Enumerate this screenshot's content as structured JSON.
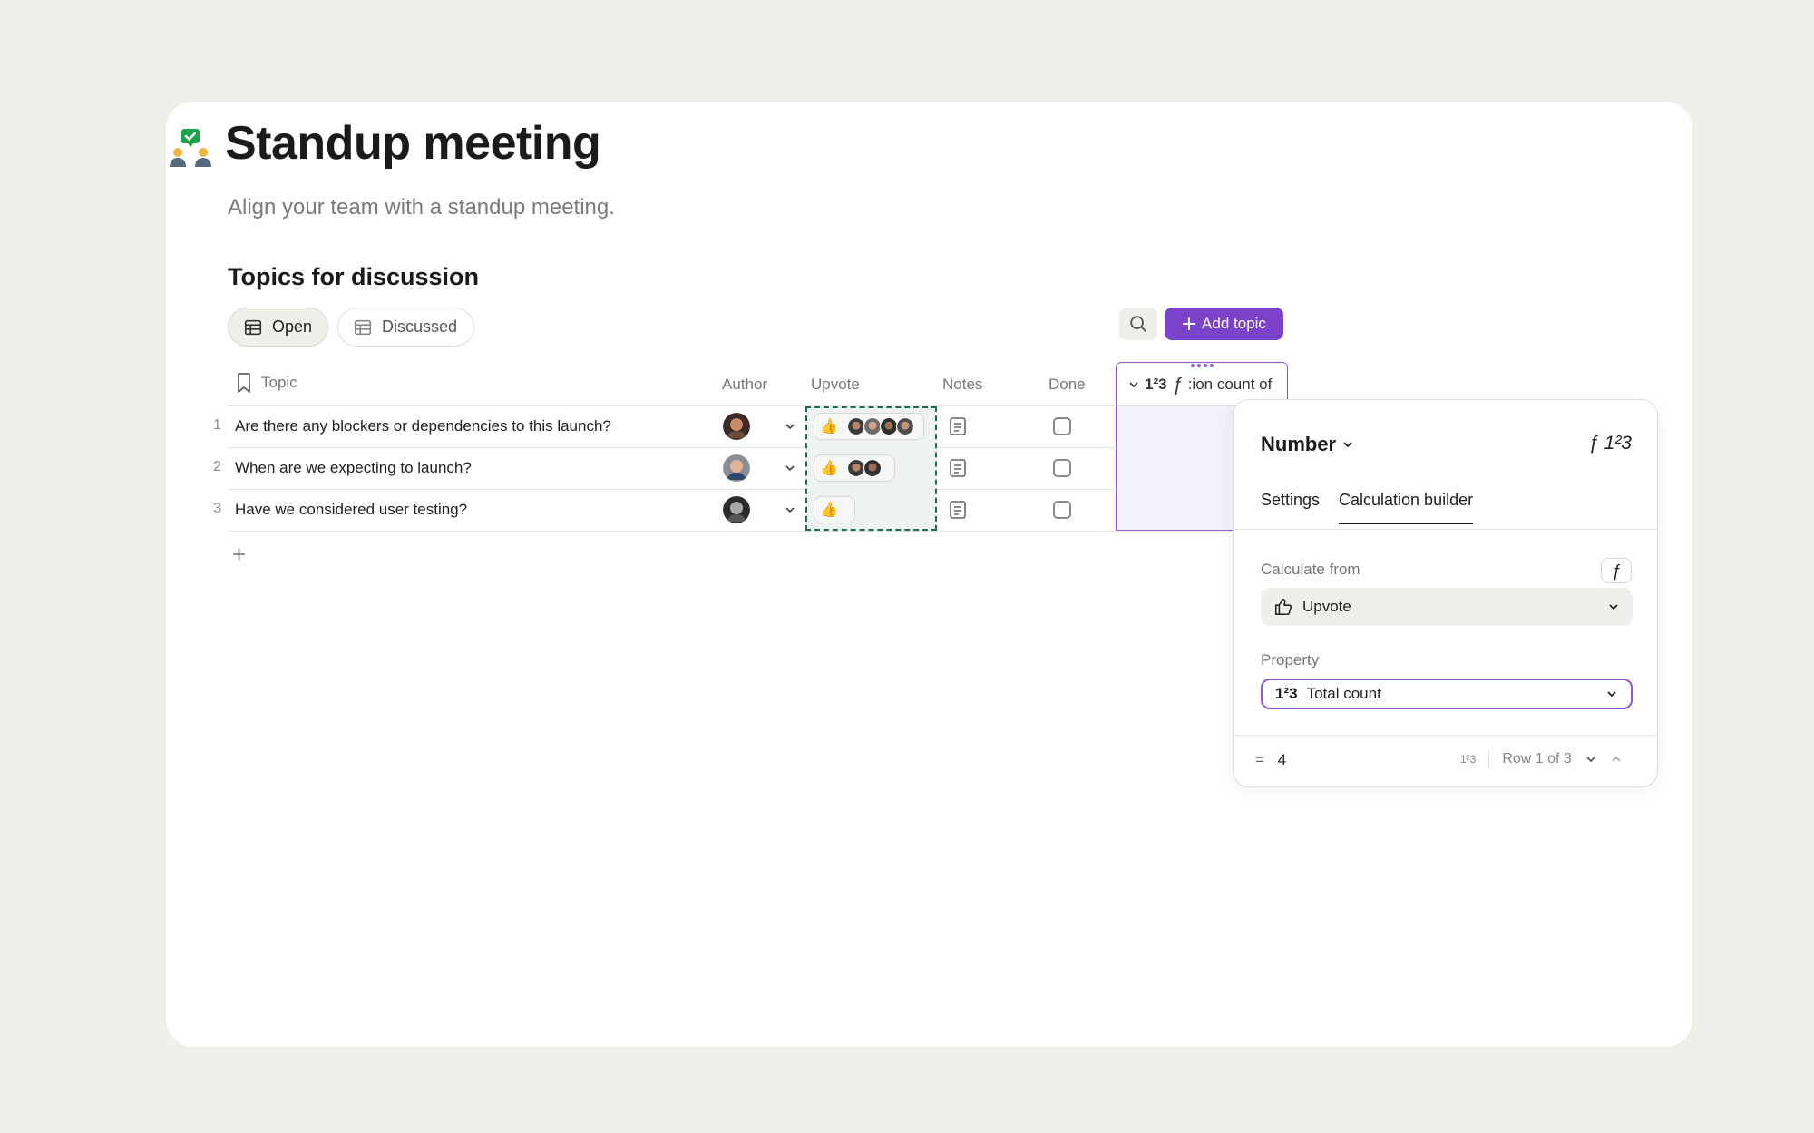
{
  "document": {
    "title": "Standup meeting",
    "subtitle": "Align your team with a standup meeting.",
    "section_title": "Topics for discussion"
  },
  "views": {
    "tabs": [
      {
        "label": "Open",
        "active": true
      },
      {
        "label": "Discussed",
        "active": false
      }
    ],
    "add_button_label": "Add topic"
  },
  "table": {
    "columns": {
      "topic": "Topic",
      "author": "Author",
      "upvote": "Upvote",
      "notes": "Notes",
      "done": "Done",
      "formula_type_glyph": "1²3",
      "formula_glyph": "ƒ",
      "formula": ":ion count of"
    },
    "rows": [
      {
        "num": "1",
        "topic": "Are there any blockers or dependencies to this launch?",
        "upvote_count": 4,
        "done": false
      },
      {
        "num": "2",
        "topic": "When are we expecting to launch?",
        "upvote_count": 2,
        "done": false
      },
      {
        "num": "3",
        "topic": "Have we considered user testing?",
        "upvote_count": 0,
        "done": false
      }
    ],
    "add_row": "+"
  },
  "panel": {
    "type_label": "Number",
    "type_glyph": "ƒ 1²3",
    "tabs": [
      {
        "label": "Settings",
        "active": false
      },
      {
        "label": "Calculation builder",
        "active": true
      }
    ],
    "calculate_from": {
      "label": "Calculate from",
      "fx_chip": "ƒ",
      "value": "Upvote"
    },
    "property": {
      "label": "Property",
      "prefix": "1²3",
      "value": "Total count"
    },
    "result": {
      "prefix": "=",
      "value": "4",
      "format_glyph": "1²3",
      "row_position": "Row 1 of 3"
    }
  },
  "colors": {
    "accent": "#7a43c9",
    "accent_border": "#8b5cd6",
    "upvote_border": "#1e6b4f",
    "background": "#f0efea"
  }
}
